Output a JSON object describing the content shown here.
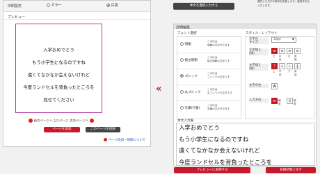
{
  "print_setting": {
    "label": "印刷設定",
    "options": [
      {
        "label": "カラー",
        "selected": false
      },
      {
        "label": "白黒",
        "selected": true
      }
    ]
  },
  "preview": {
    "label": "プレビュー",
    "lines": [
      "入学おめでとう",
      "もう小学生になるのですね",
      "遠くてなかなか会えないけれど",
      "今度ランドセルを背負ったところを",
      "見せてください"
    ],
    "nav": {
      "prev": "前のページへ",
      "page": "1/1ページ",
      "next": "次のページへ"
    },
    "add_page_button": "ページを追加",
    "delete_page_button": "このページを削除",
    "help_link": "ページ追加・削除について"
  },
  "top_right": {
    "button": "本文を連続入力する",
    "note_line1": "選択した文字の書体を変更します。連続本文を",
    "note_line2": "入力します。"
  },
  "detail": {
    "title": "詳細編集",
    "font_section": "フォント選択",
    "fonts": [
      {
        "name": "明朝",
        "selected": false,
        "sample1": "この行は",
        "sample2": "明朝の文字がでます"
      },
      {
        "name": "楷古明朝",
        "selected": false,
        "sample1": "この行は",
        "sample2": "楷古明朝の文字です"
      },
      {
        "name": "ゴシック",
        "selected": true,
        "sample1": "この行は",
        "sample2": "ゴシックの文字です"
      },
      {
        "name": "丸ゴシック",
        "selected": false,
        "sample1": "この行は",
        "sample2": "丸ゴシックの文字です"
      },
      {
        "name": "毛筆(行書)",
        "selected": false,
        "sample1": "この行は",
        "sample2": "毛筆の文字がでます"
      }
    ],
    "style_section": "スタイル・レイアウト",
    "size_label": "文字の\nサイズ",
    "size_value": "20pt",
    "halign_label": "文字揃え\n(横)",
    "halign_opts": [
      "左",
      "中央",
      "右",
      "両端"
    ],
    "valign_label": "文字揃え\n(縦)",
    "valign_opts": [
      "上",
      "中央",
      "下",
      "両端"
    ],
    "color_label": "文字の色",
    "direction_label": "入力方向",
    "direction_opts": [
      "横書",
      "縦書"
    ]
  },
  "text_input": {
    "label": "本文入力欄",
    "lines": [
      "入学おめでとう",
      "もう小学生になるのですね",
      "遠くてなかなか会えないけれど",
      "今度ランドセルを背負ったところを"
    ]
  },
  "bottom": {
    "apply_button": "プレビューに反映する",
    "reset_button": "初期状態に戻す"
  },
  "colors": {
    "accent": "#c8192b",
    "frame": "#b03aa7"
  }
}
